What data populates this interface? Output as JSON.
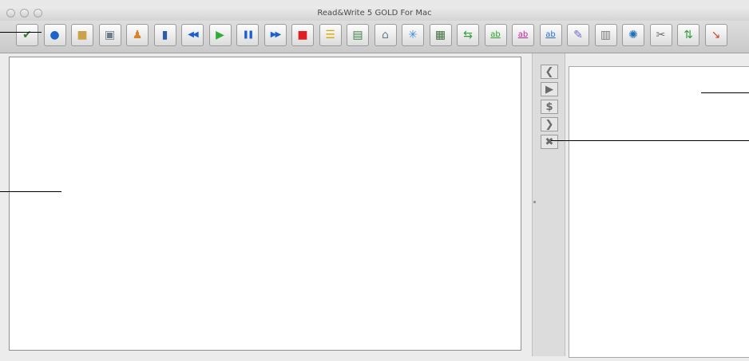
{
  "window": {
    "title": "Read&Write 5 GOLD For Mac"
  },
  "toolbar": {
    "buttons": [
      {
        "name": "spell-check-button",
        "icon": "spell-check-icon",
        "glyph": "✔",
        "color": "#2e7d32"
      },
      {
        "name": "globe-button",
        "icon": "globe-icon",
        "glyph": "●",
        "color": "#1e63c7"
      },
      {
        "name": "dictionary-button",
        "icon": "book-icon",
        "glyph": "■",
        "color": "#c9a24a"
      },
      {
        "name": "picture-dictionary-button",
        "icon": "picture-dictionary-icon",
        "glyph": "▣",
        "color": "#6b7d8c"
      },
      {
        "name": "homophones-button",
        "icon": "person-icon",
        "glyph": "♟",
        "color": "#d9822b"
      },
      {
        "name": "word-wizard-button",
        "icon": "blue-book-icon",
        "glyph": "▮",
        "color": "#2c5ea8"
      },
      {
        "name": "rewind-button",
        "icon": "rewind-icon",
        "glyph": "◀◀",
        "color": "#1e5fcf"
      },
      {
        "name": "play-button",
        "icon": "play-icon",
        "glyph": "▶",
        "color": "#2fae35"
      },
      {
        "name": "pause-button",
        "icon": "pause-icon",
        "glyph": "❚❚",
        "color": "#1e5fcf"
      },
      {
        "name": "fast-forward-button",
        "icon": "fast-forward-icon",
        "glyph": "▶▶",
        "color": "#1e5fcf"
      },
      {
        "name": "stop-button",
        "icon": "stop-icon",
        "glyph": "■",
        "color": "#e02020"
      },
      {
        "name": "highlight-button",
        "icon": "highlight-icon",
        "glyph": "☰",
        "color": "#d9a800"
      },
      {
        "name": "screenshot-reader-button",
        "icon": "screenshot-reader-icon",
        "glyph": "▤",
        "color": "#3f7f3f"
      },
      {
        "name": "scan-button",
        "icon": "scanner-icon",
        "glyph": "⌂",
        "color": "#6a7f8f"
      },
      {
        "name": "fact-finder-button",
        "icon": "sparkle-icon",
        "glyph": "✳",
        "color": "#3b8fd9"
      },
      {
        "name": "screen-masking-button",
        "icon": "monitor-icon",
        "glyph": "▦",
        "color": "#3f6f3f"
      },
      {
        "name": "translator-button",
        "icon": "translate-icon",
        "glyph": "⇆",
        "color": "#2e9d3a"
      },
      {
        "name": "highlighter-yellow-button",
        "icon": "ab-highlight-icon",
        "glyph": "ab",
        "color": "#2aa02a"
      },
      {
        "name": "highlighter-pink-button",
        "icon": "ab-highlight-icon",
        "glyph": "ab",
        "color": "#c2259a"
      },
      {
        "name": "highlighter-outline-button",
        "icon": "ab-highlight-icon",
        "glyph": "ab",
        "color": "#2b6bd0"
      },
      {
        "name": "collect-highlights-button",
        "icon": "collect-highlights-icon",
        "glyph": "✎",
        "color": "#6b6bd0"
      },
      {
        "name": "calculator-button",
        "icon": "calculator-icon",
        "glyph": "▥",
        "color": "#7a7a7a"
      },
      {
        "name": "web-button",
        "icon": "web-icon",
        "glyph": "✺",
        "color": "#1f6fb5"
      },
      {
        "name": "settings-button",
        "icon": "tools-icon",
        "glyph": "✂",
        "color": "#6a6a6a"
      },
      {
        "name": "word-prediction-button",
        "icon": "up-down-arrows-icon",
        "glyph": "⇅",
        "color": "#2e9d3a"
      },
      {
        "name": "help-button",
        "icon": "help-arrow-icon",
        "glyph": "↘",
        "color": "#c94a2a"
      }
    ]
  },
  "side_controls": [
    {
      "name": "previous-button",
      "icon": "chevron-left-icon",
      "glyph": "❮"
    },
    {
      "name": "play-suggestion-button",
      "icon": "play-icon",
      "glyph": "▶"
    },
    {
      "name": "pronounce-button",
      "icon": "ear-icon",
      "glyph": "$"
    },
    {
      "name": "next-button",
      "icon": "chevron-right-icon",
      "glyph": "❯"
    },
    {
      "name": "close-panel-button",
      "icon": "close-x-icon",
      "glyph": "✖"
    }
  ]
}
